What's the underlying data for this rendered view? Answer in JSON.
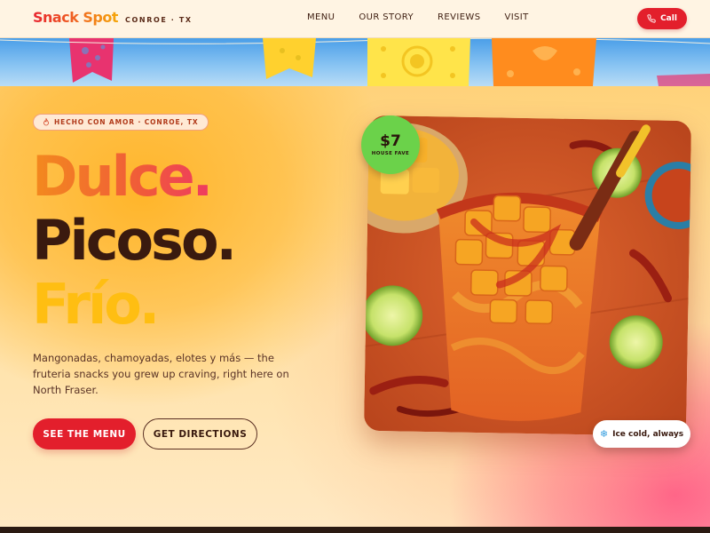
{
  "header": {
    "brand_name": "Snack Spot",
    "brand_location": "CONROE · TX",
    "nav": [
      "MENU",
      "OUR STORY",
      "REVIEWS",
      "VISIT"
    ],
    "call_label": "Call"
  },
  "hero": {
    "tagline": "HECHO CON AMOR · CONROE, TX",
    "headline": [
      "Dulce.",
      "Picoso.",
      "Frío."
    ],
    "subtext": "Mangonadas, chamoyadas, elotes y más — the fruteria snacks you grew up craving, right here on North Fraser.",
    "primary_cta": "SEE THE MENU",
    "secondary_cta": "GET DIRECTIONS"
  },
  "photo": {
    "price": "$7",
    "price_label": "HOUSE FAVE",
    "chip_label": "Ice cold, always",
    "chip_icon": "snowflake-icon"
  },
  "colors": {
    "brand_red": "#e31f2c",
    "brand_orange": "#f06a20",
    "headline_dark": "#3a1a0f",
    "headline_yellow": "#ffbe12",
    "badge_green": "#6bd24a"
  }
}
